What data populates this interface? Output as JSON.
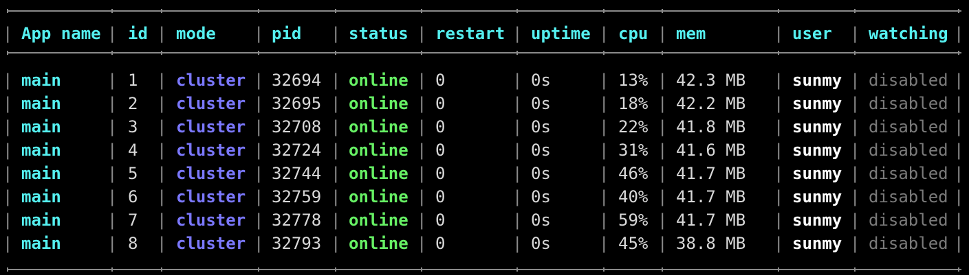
{
  "table": {
    "columns": [
      "App name",
      "id",
      "mode",
      "pid",
      "status",
      "restart",
      "uptime",
      "cpu",
      "mem",
      "user",
      "watching"
    ],
    "rows": [
      {
        "app_name": "main",
        "id": "1",
        "mode": "cluster",
        "pid": "32694",
        "status": "online",
        "restart": "0",
        "uptime": "0s",
        "cpu": "13%",
        "mem": "42.3 MB",
        "user": "sunmy",
        "watching": "disabled"
      },
      {
        "app_name": "main",
        "id": "2",
        "mode": "cluster",
        "pid": "32695",
        "status": "online",
        "restart": "0",
        "uptime": "0s",
        "cpu": "18%",
        "mem": "42.2 MB",
        "user": "sunmy",
        "watching": "disabled"
      },
      {
        "app_name": "main",
        "id": "3",
        "mode": "cluster",
        "pid": "32708",
        "status": "online",
        "restart": "0",
        "uptime": "0s",
        "cpu": "22%",
        "mem": "41.8 MB",
        "user": "sunmy",
        "watching": "disabled"
      },
      {
        "app_name": "main",
        "id": "4",
        "mode": "cluster",
        "pid": "32724",
        "status": "online",
        "restart": "0",
        "uptime": "0s",
        "cpu": "31%",
        "mem": "41.6 MB",
        "user": "sunmy",
        "watching": "disabled"
      },
      {
        "app_name": "main",
        "id": "5",
        "mode": "cluster",
        "pid": "32744",
        "status": "online",
        "restart": "0",
        "uptime": "0s",
        "cpu": "46%",
        "mem": "41.7 MB",
        "user": "sunmy",
        "watching": "disabled"
      },
      {
        "app_name": "main",
        "id": "6",
        "mode": "cluster",
        "pid": "32759",
        "status": "online",
        "restart": "0",
        "uptime": "0s",
        "cpu": "40%",
        "mem": "41.7 MB",
        "user": "sunmy",
        "watching": "disabled"
      },
      {
        "app_name": "main",
        "id": "7",
        "mode": "cluster",
        "pid": "32778",
        "status": "online",
        "restart": "0",
        "uptime": "0s",
        "cpu": "59%",
        "mem": "41.7 MB",
        "user": "sunmy",
        "watching": "disabled"
      },
      {
        "app_name": "main",
        "id": "8",
        "mode": "cluster",
        "pid": "32793",
        "status": "online",
        "restart": "0",
        "uptime": "0s",
        "cpu": "45%",
        "mem": "38.8 MB",
        "user": "sunmy",
        "watching": "disabled"
      }
    ]
  },
  "colors": {
    "background": "#000000",
    "header_text": "#55f0f0",
    "app_name": "#55f0f0",
    "mode": "#7b78ff",
    "status_online": "#66f064",
    "user": "#ffffff",
    "watching_disabled": "#7a7a7a",
    "border": "#8a8a8a"
  }
}
